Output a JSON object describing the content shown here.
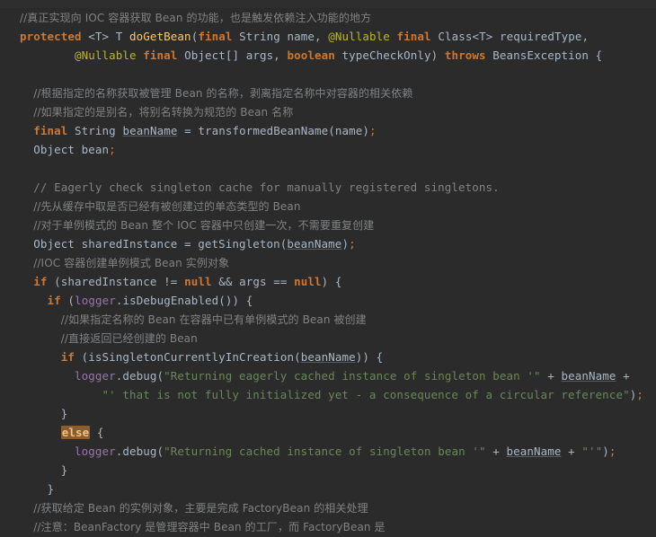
{
  "editor": {
    "theme_name": "darcula",
    "background_color": "#2b2b2b",
    "default_text_color": "#a9b7c6",
    "comment_color": "#7f8386",
    "keyword_color": "#cc7832",
    "method_color": "#ffc66d",
    "annotation_color": "#bbb529",
    "string_color": "#6a8759",
    "field_color": "#9876aa",
    "highlight_background_color": "#8c5c2b",
    "language": "Java"
  },
  "code": {
    "lines": [
      {
        "n": 1,
        "indent": 0,
        "text": "//真正实现向 IOC 容器获取 Bean 的功能，也是触发依赖注入功能的地方"
      },
      {
        "n": 2,
        "indent": 0,
        "text": "protected <T> T doGetBean(final String name, @Nullable final Class<T> requiredType,"
      },
      {
        "n": 3,
        "indent": 4,
        "text": "@Nullable final Object[] args, boolean typeCheckOnly) throws BeansException {"
      },
      {
        "n": 4,
        "indent": 0,
        "text": ""
      },
      {
        "n": 5,
        "indent": 1,
        "text": "//根据指定的名称获取被管理 Bean 的名称，剥离指定名称中对容器的相关依赖"
      },
      {
        "n": 6,
        "indent": 1,
        "text": "//如果指定的是别名，将别名转换为规范的 Bean 名称"
      },
      {
        "n": 7,
        "indent": 1,
        "text": "final String beanName = transformedBeanName(name);"
      },
      {
        "n": 8,
        "indent": 1,
        "text": "Object bean;"
      },
      {
        "n": 9,
        "indent": 0,
        "text": ""
      },
      {
        "n": 10,
        "indent": 1,
        "text": "// Eagerly check singleton cache for manually registered singletons."
      },
      {
        "n": 11,
        "indent": 1,
        "text": "//先从缓存中取是否已经有被创建过的单态类型的 Bean"
      },
      {
        "n": 12,
        "indent": 1,
        "text": "//对于单例模式的 Bean 整个 IOC 容器中只创建一次，不需要重复创建"
      },
      {
        "n": 13,
        "indent": 1,
        "text": "Object sharedInstance = getSingleton(beanName);"
      },
      {
        "n": 14,
        "indent": 1,
        "text": "//IOC 容器创建单例模式 Bean 实例对象"
      },
      {
        "n": 15,
        "indent": 1,
        "text": "if (sharedInstance != null && args == null) {"
      },
      {
        "n": 16,
        "indent": 2,
        "text": "if (logger.isDebugEnabled()) {"
      },
      {
        "n": 17,
        "indent": 3,
        "text": "//如果指定名称的 Bean 在容器中已有单例模式的 Bean 被创建"
      },
      {
        "n": 18,
        "indent": 3,
        "text": "//直接返回已经创建的 Bean"
      },
      {
        "n": 19,
        "indent": 3,
        "text": "if (isSingletonCurrentlyInCreation(beanName)) {"
      },
      {
        "n": 20,
        "indent": 4,
        "text": "logger.debug(\"Returning eagerly cached instance of singleton bean '\" + beanName +"
      },
      {
        "n": 21,
        "indent": 6,
        "text": "\"' that is not fully initialized yet - a consequence of a circular reference\");"
      },
      {
        "n": 22,
        "indent": 3,
        "text": "}"
      },
      {
        "n": 23,
        "indent": 3,
        "text": "else {"
      },
      {
        "n": 24,
        "indent": 4,
        "text": "logger.debug(\"Returning cached instance of singleton bean '\" + beanName + \"'\");"
      },
      {
        "n": 25,
        "indent": 3,
        "text": "}"
      },
      {
        "n": 26,
        "indent": 2,
        "text": "}"
      },
      {
        "n": 27,
        "indent": 1,
        "text": "//获取给定 Bean 的实例对象，主要是完成 FactoryBean 的相关处理"
      },
      {
        "n": 28,
        "indent": 1,
        "text": "//注意：BeanFactory 是管理容器中 Bean 的工厂，而 FactoryBean 是"
      }
    ],
    "highlighted_token": "else",
    "method_signature_name": "doGetBean",
    "annotations": [
      "@Nullable"
    ],
    "keywords_used": [
      "protected",
      "final",
      "boolean",
      "throws",
      "if",
      "else",
      "null"
    ],
    "field_references": [
      "logger"
    ],
    "string_literals": [
      "Returning eagerly cached instance of singleton bean '",
      "' that is not fully initialized yet - a consequence of a circular reference",
      "Returning cached instance of singleton bean '",
      "'"
    ]
  }
}
